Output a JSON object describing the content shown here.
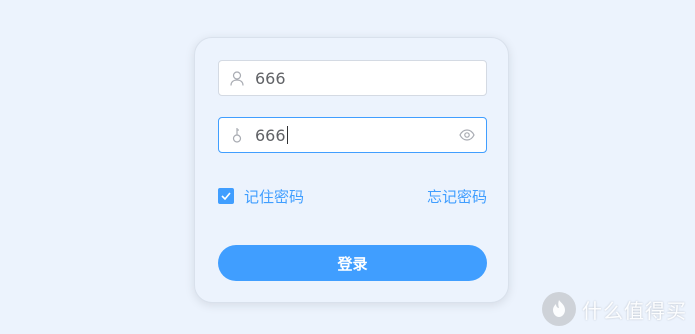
{
  "colors": {
    "page_bg": "#ecf3fd",
    "accent": "#409eff",
    "input_border": "#d4dae3",
    "text": "#606266"
  },
  "form": {
    "username": {
      "value": "666",
      "icon": "user-icon"
    },
    "password": {
      "value": "666",
      "icon": "key-icon",
      "toggle_icon": "eye-icon",
      "focused": true
    },
    "remember": {
      "label": "记住密码",
      "checked": true
    },
    "forgot_link": "忘记密码",
    "submit_label": "登录"
  },
  "watermark": {
    "text": "什么值得买",
    "logo": "值"
  }
}
